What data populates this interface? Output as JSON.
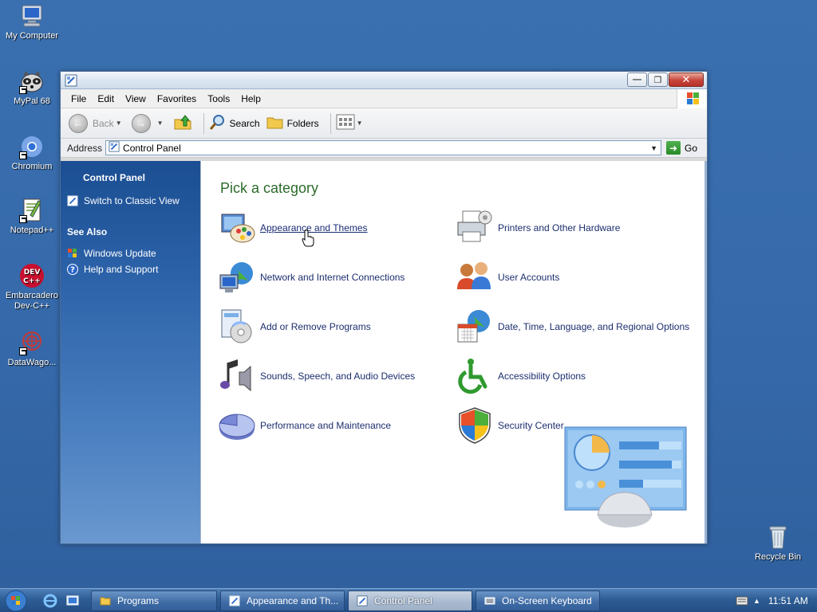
{
  "desktop": {
    "icons": [
      {
        "label": "My Computer"
      },
      {
        "label": "MyPal 68"
      },
      {
        "label": "Chromium"
      },
      {
        "label": "Notepad++"
      },
      {
        "label": "Embarcadero Dev-C++"
      },
      {
        "label": "DataWago..."
      },
      {
        "label": "Recycle Bin"
      }
    ]
  },
  "window": {
    "menu": [
      "File",
      "Edit",
      "View",
      "Favorites",
      "Tools",
      "Help"
    ],
    "toolbar": {
      "back_label": "Back",
      "search_label": "Search",
      "folders_label": "Folders"
    },
    "address": {
      "label": "Address",
      "value": "Control Panel",
      "go_label": "Go"
    },
    "sidebar": {
      "heading": "Control Panel",
      "switch_link": "Switch to Classic View",
      "see_also_heading": "See Also",
      "links": [
        "Windows Update",
        "Help and Support"
      ]
    },
    "main": {
      "title": "Pick a category",
      "categories": [
        {
          "label": "Appearance and Themes"
        },
        {
          "label": "Printers and Other Hardware"
        },
        {
          "label": "Network and Internet Connections"
        },
        {
          "label": "User Accounts"
        },
        {
          "label": "Add or Remove Programs"
        },
        {
          "label": "Date, Time, Language, and Regional Options"
        },
        {
          "label": "Sounds, Speech, and Audio Devices"
        },
        {
          "label": "Accessibility Options"
        },
        {
          "label": "Performance and Maintenance"
        },
        {
          "label": "Security Center"
        }
      ]
    }
  },
  "taskbar": {
    "tasks": [
      {
        "label": "Programs"
      },
      {
        "label": "Appearance and Th..."
      },
      {
        "label": "Control Panel"
      },
      {
        "label": "On-Screen Keyboard"
      }
    ],
    "clock": "11:51 AM"
  },
  "colors": {
    "desktop_bg": "#3a6ea5",
    "sidebar_top": "#1b4e92",
    "title_green": "#2c6b2c",
    "link_blue": "#1c2e6e"
  }
}
